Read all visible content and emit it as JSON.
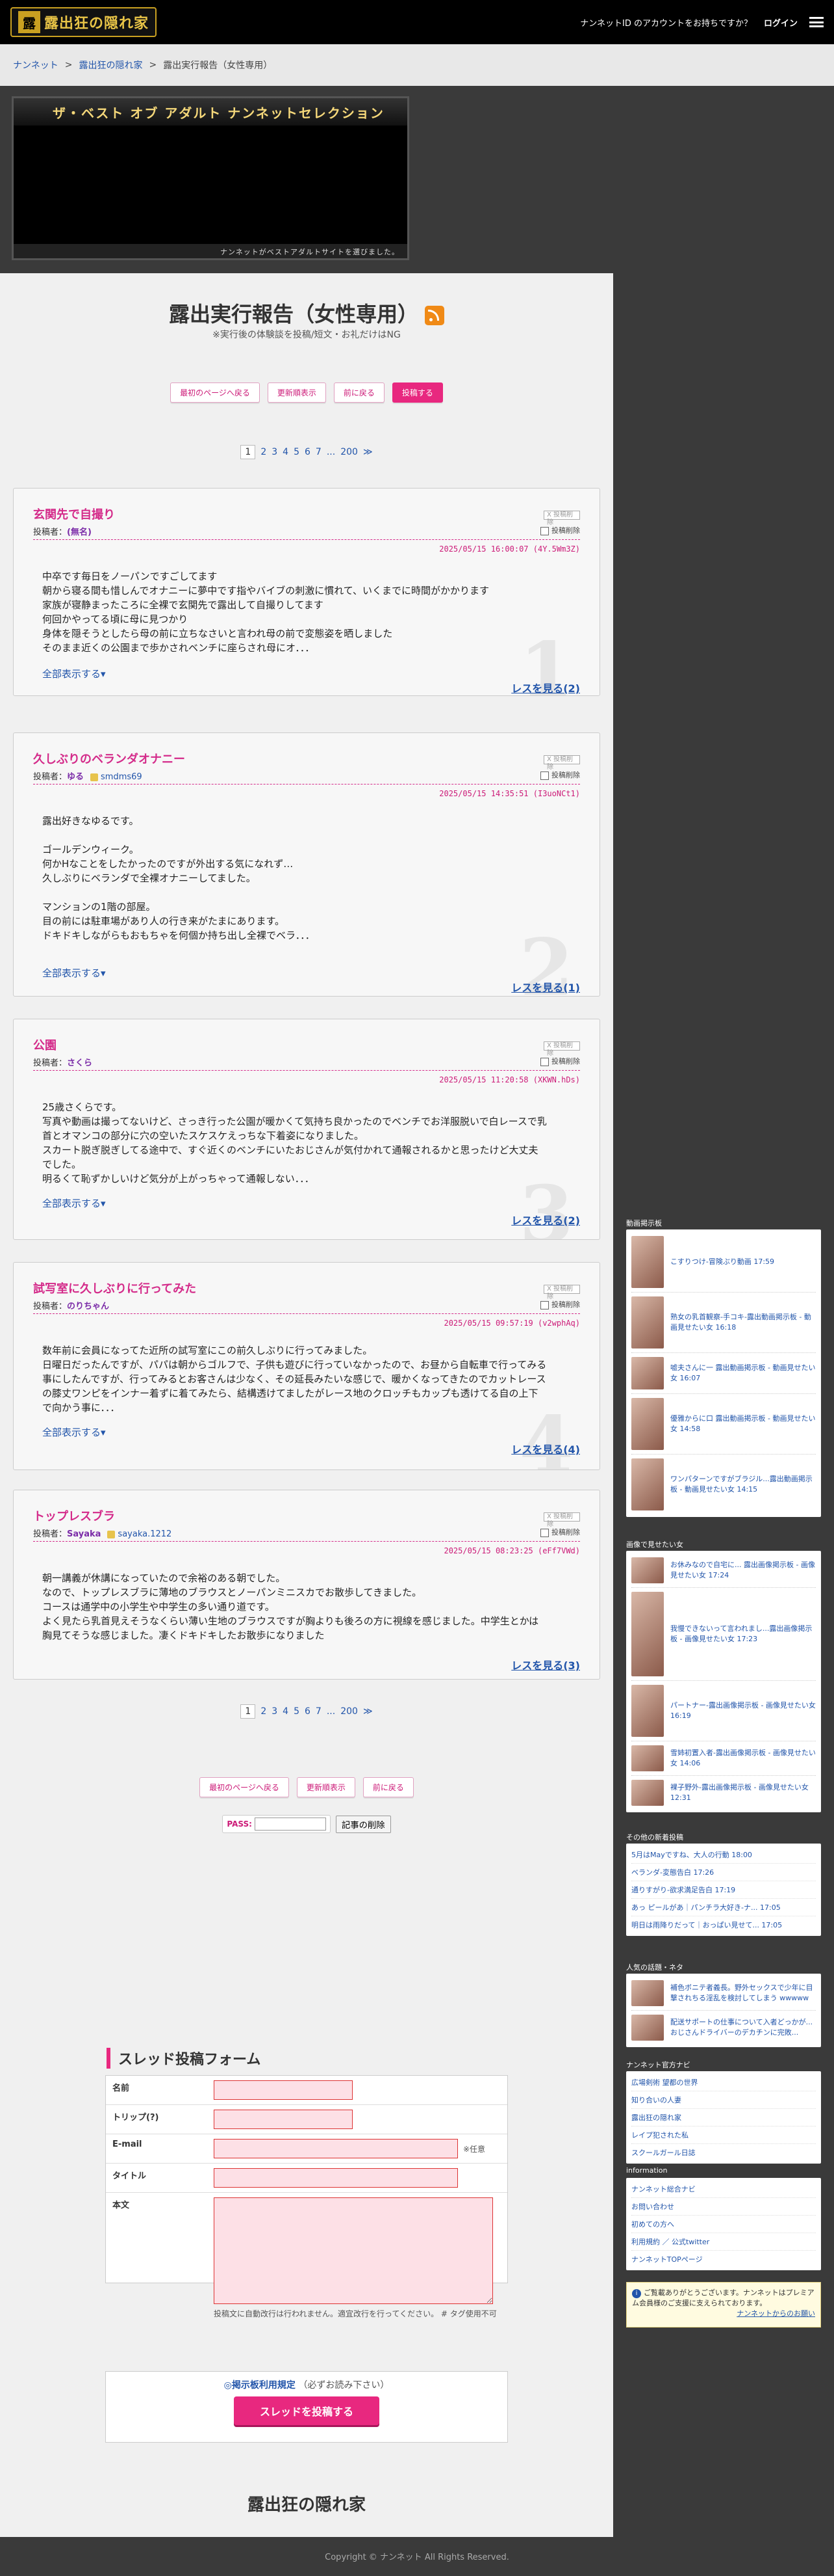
{
  "header": {
    "logo_text": "露出狂の隠れ家",
    "account_prompt": "ナンネットID のアカウントをお持ちですか？",
    "login": "ログイン"
  },
  "breadcrumb": [
    "ナンネット",
    "露出狂の隠れ家",
    "露出実行報告（女性専用）"
  ],
  "ad": {
    "title": "ザ・ベスト オブ アダルト ナンネットセレクション",
    "footer": "ナンネットがベストアダルトサイトを選びました。"
  },
  "board": {
    "title": "露出実行報告（女性専用）",
    "subtitle": "※実行後の体験談を投稿/短文・お礼だけはNG"
  },
  "nav_buttons": {
    "first": "最初のページへ戻る",
    "updated": "更新順表示",
    "back": "前に戻る",
    "post": "投稿する"
  },
  "pager": {
    "pages": [
      "1",
      "2",
      "3",
      "4",
      "5",
      "6",
      "7"
    ],
    "ellipsis": "...",
    "last": "200",
    "next": "≫"
  },
  "thread_ui": {
    "author_prefix": "投稿者：",
    "more": "全部表示する▾",
    "delete": "投稿削除",
    "x_label": "X 投稿削除"
  },
  "threads": [
    {
      "title": "玄関先で自撮り",
      "author": "(無名)",
      "trip": "",
      "date": "2025/05/15 16:00:07 (4Y.5Wm3Z)",
      "body": "中卒です毎日をノーパンですごしてます\n朝から寝る間も惜しんでオナニーに夢中です指やバイブの刺激に慣れて、いくまでに時間がかかります\n家族が寝静まったころに全裸で玄関先で露出して自撮りしてます\n何回かやってる頃に母に見つかり\n身体を隠そうとしたら母の前に立ちなさいと言われ母の前で変態姿を晒しました\nそのまま近くの公園まで歩かされベンチに座らされ母にオ．．．",
      "reply": "レスを見る(2)",
      "num": "1"
    },
    {
      "title": "久しぶりのベランダオナニー",
      "author": "ゆる",
      "trip": "smdms69",
      "date": "2025/05/15 14:35:51 (I3uoNCt1)",
      "body": "露出好きなゆるです。\n\nゴールデンウィーク。\n何かHなことをしたかったのですが外出する気になれず…\n久しぶりにベランダで全裸オナニーしてました。\n\nマンションの1階の部屋。\n目の前には駐車場があり人の行き来がたまにあります。\nドキドキしながらもおもちゃを何個か持ち出し全裸でベラ．．．",
      "reply": "レスを見る(1)",
      "num": "2"
    },
    {
      "title": "公園",
      "author": "さくら",
      "trip": "",
      "date": "2025/05/15 11:20:58 (XKWN.hDs)",
      "body": "25歳さくらです。\n写真や動画は撮ってないけど、さっき行った公園が暖かくて気持ち良かったのでベンチでお洋服脱いで白レースで乳首とオマンコの部分に穴の空いたスケスケえっちな下着姿になりました。\nスカート脱ぎ脱ぎしてる途中で、すぐ近くのベンチにいたおじさんが気付かれて通報されるかと思ったけど大丈夫でした。\n明るくて恥ずかしいけど気分が上がっちゃって通報しない．．．",
      "reply": "レスを見る(2)",
      "num": "3"
    },
    {
      "title": "試写室に久しぶりに行ってみた",
      "author": "のりちゃん",
      "trip": "",
      "date": "2025/05/15 09:57:19 (v2wphAq)",
      "body": "数年前に会員になってた近所の試写室にこの前久しぶりに行ってみました。\n日曜日だったんですが、パパは朝からゴルフで、子供も遊びに行っていなかったので、お昼から自転車で行ってみる事にしたんですが、行ってみるとお客さんは少なく、その延長みたいな感じで、暖かくなってきたのでカットレースの膝丈ワンピをインナー着ずに着てみたら、結構透けてましたがレース地のクロッチもカップも透けてる自の上下で向かう事に．．．",
      "reply": "レスを見る(4)",
      "num": "4"
    },
    {
      "title": "トップレスブラ",
      "author": "Sayaka",
      "trip": "sayaka.1212",
      "date": "2025/05/15 08:23:25 (eFf7VWd)",
      "body": "朝一講義が休講になっていたので余裕のある朝でした。\nなので、トップレスブラに薄地のブラウスとノーパンミニスカでお散歩してきました。\nコースは通学中の小学生や中学生の多い通り道です。\nよく見たら乳首見えそうなくらい薄い生地のブラウスですが胸よりも後ろの方に視線を感じました。中学生とかは胸見てそうな感じました。凄くドキドキしたお散歩になりました",
      "reply": "レスを見る(3)",
      "num": ""
    }
  ],
  "password": {
    "label": "PASS:",
    "delete": "記事の削除"
  },
  "form": {
    "heading": "スレッド投稿フォーム",
    "name": "名前",
    "trip": "トリップ(?)",
    "email": "E-mail",
    "email_note": "※任意",
    "title": "タイトル",
    "body": "本文",
    "body_note": "投稿文に自動改行は行われません。適宜改行を行ってください。 # タグ使用不可",
    "rules_link": "◎掲示板利用規定",
    "rules_note": "（必ずお読み下さい）",
    "submit": "スレッドを投稿する"
  },
  "footer": {
    "site_name": "露出狂の隠れ家",
    "copyright": "Copyright © ナンネット All Rights Reserved."
  },
  "sidebar": {
    "video_head": "動画掲示板",
    "videos": [
      "こすりつけ-冒険ぶり動画 17:59",
      "熟女の乳首観察-手コキ-露出動画掲示板 - 動画見せたい女 16:18",
      "嘘夫さんに一 露出動画掲示板 - 動画見せたい女 16:07",
      "優雅からに口 露出動画掲示板 - 動画見せたい女 14:58",
      "ワンパターンですがブラジル...露出動画掲示板 - 動画見せたい女 14:15"
    ],
    "image_head": "画像で見せたい女",
    "images": [
      "お休みなので自宅に... 露出画像掲示板 - 画像見せたい女 17:24",
      "我慢できないって言われまし...露出画像掲示板 - 画像見せたい女 17:23",
      "パートナー-露出画像掲示板 - 画像見せたい女 16:19",
      "雪姉初置入者-露出画像掲示板 - 画像見せたい女 14:06",
      "裸子野外-露出画像掲示板 - 画像見せたい女 12:31"
    ],
    "board_head": "その他の新着投稿",
    "boards": [
      "5月はMayですね、大人の行動 18:00",
      "ベランダ-変態告白 17:26",
      "通りすがり-欲求満足告白 17:19",
      "あっ ピールがあ｜パンチラ大好き-ナ... 17:05",
      "明日は雨降りだって｜おっぱい見せて... 17:05"
    ],
    "story_head": "人気の話題・ネタ",
    "stories": [
      "補色ボニテ者義長。野外セックスで少年に目撃されちる淫乱を検討してしまう wwwww",
      "配送サポートの仕事について入者どっかが...おじさんドライバーのデカチンに完敗..."
    ],
    "nanet_head": "ナンネット官方ナビ",
    "nanet_links": [
      "広場剣術 望都の世界",
      "知り合いの人妻",
      "露出狂の隠れ家",
      "レイプ犯された私",
      "スクールガール日誌"
    ],
    "info_head": "information",
    "info_links": [
      "ナンネット総合ナビ",
      "お問い合わせ",
      "初めての方へ",
      "利用規約 ／ 公式twitter",
      "ナンネットTOPページ"
    ],
    "notice": "ご覧載ありがとうございます。ナンネットはプレミアム会員様のご支援に支えられております。",
    "notice_link": "ナンネットからのお願い"
  }
}
